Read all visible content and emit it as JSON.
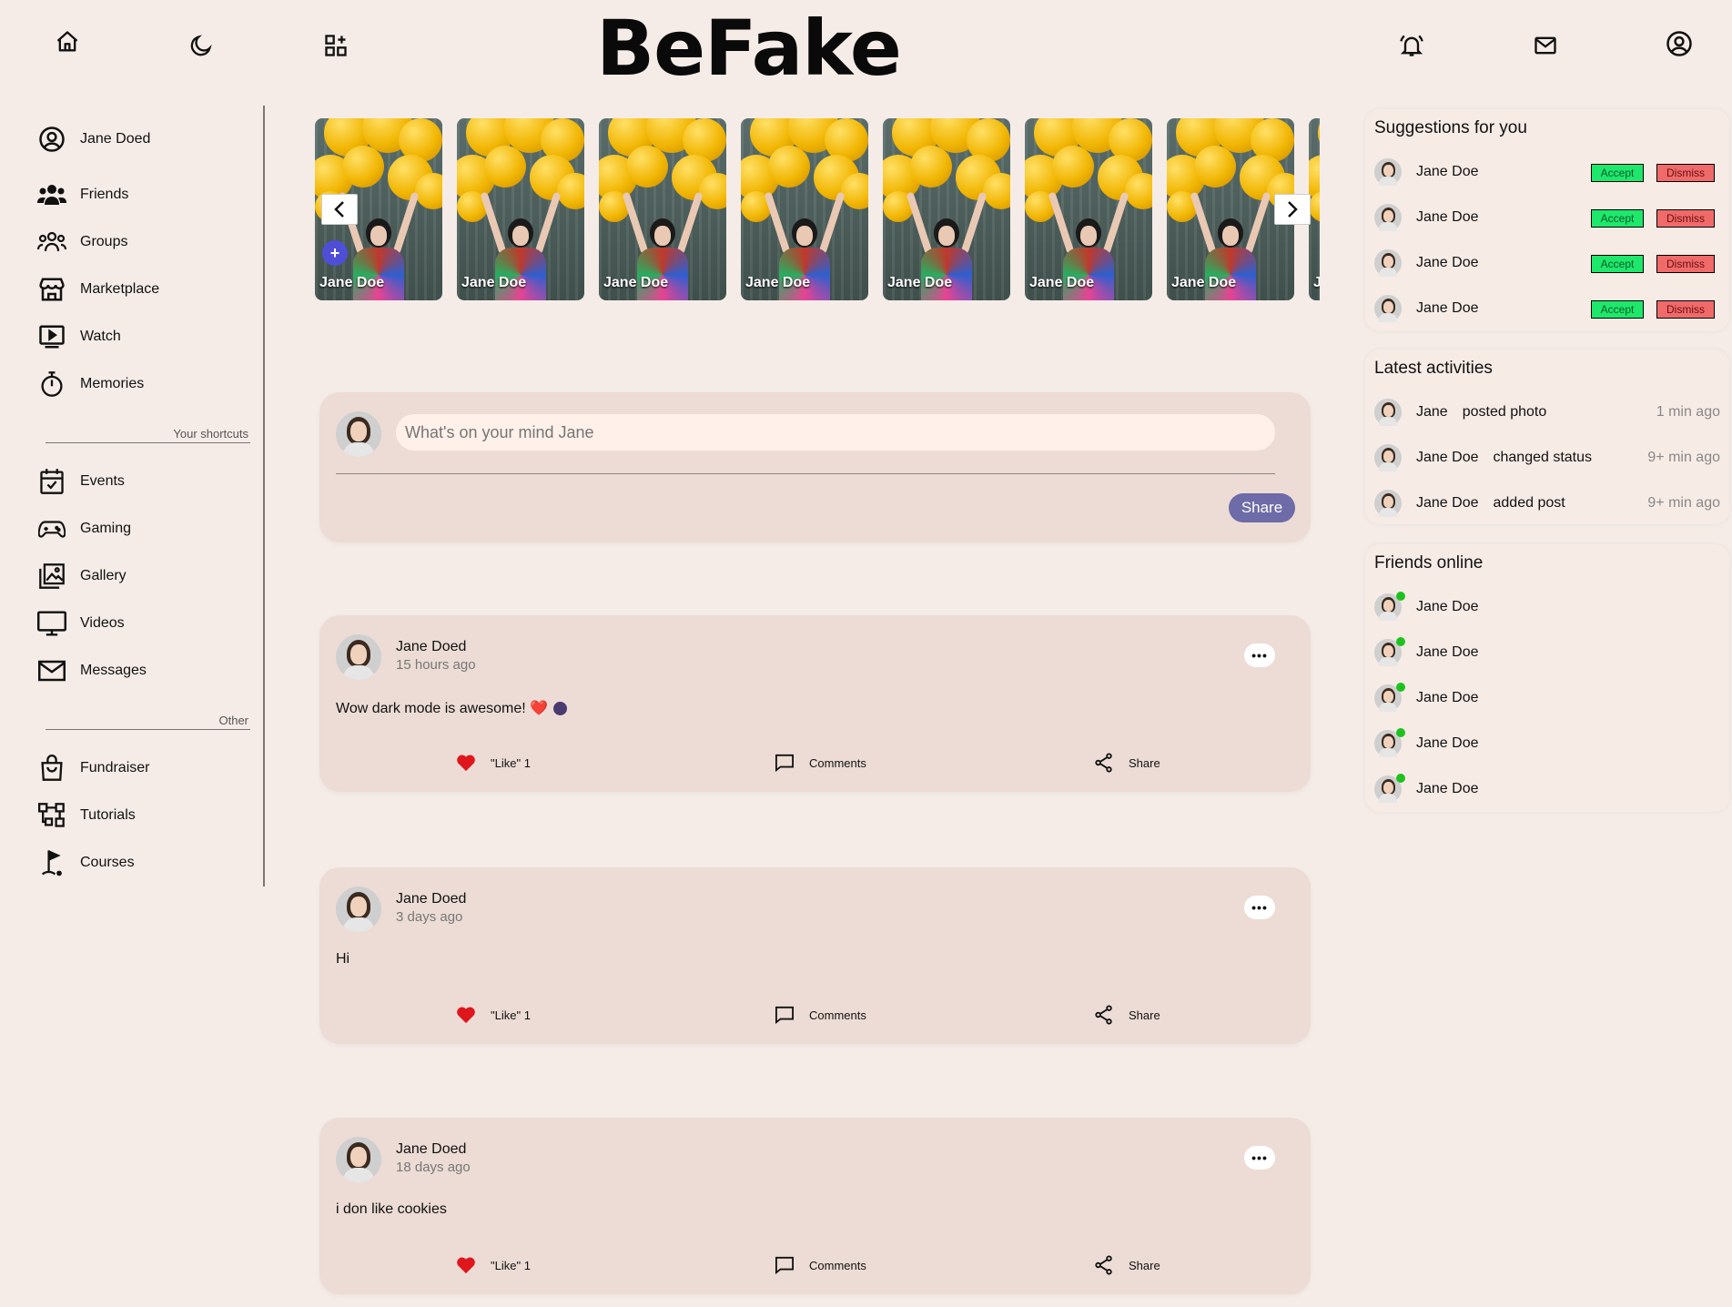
{
  "app": {
    "brand": "BeFake"
  },
  "topbar": {
    "icons": [
      "home-icon",
      "moon-icon",
      "grid-plus-icon",
      "bell-icon",
      "mail-icon",
      "user-circle-icon"
    ]
  },
  "sidebar": {
    "profile": "Jane Doed",
    "main": [
      "Friends",
      "Groups",
      "Marketplace",
      "Watch",
      "Memories"
    ],
    "shortcuts_label": "Your shortcuts",
    "shortcuts": [
      "Events",
      "Gaming",
      "Gallery",
      "Videos",
      "Messages"
    ],
    "other_label": "Other",
    "other": [
      "Fundraiser",
      "Tutorials",
      "Courses"
    ]
  },
  "stories": [
    "Jane Doe",
    "Jane Doe",
    "Jane Doe",
    "Jane Doe",
    "Jane Doe",
    "Jane Doe",
    "Jane Doe",
    "J"
  ],
  "composer": {
    "placeholder": "What's on your mind Jane",
    "share": "Share"
  },
  "posts": [
    {
      "author": "Jane Doed",
      "time": "15 hours ago",
      "text": "Wow dark mode is awesome! ❤️",
      "like": "\"Like\" 1",
      "comments": "Comments",
      "share": "Share"
    },
    {
      "author": "Jane Doed",
      "time": "3 days ago",
      "text": "Hi",
      "like": "\"Like\" 1",
      "comments": "Comments",
      "share": "Share"
    },
    {
      "author": "Jane Doed",
      "time": "18 days ago",
      "text": "i don like cookies",
      "like": "\"Like\" 1",
      "comments": "Comments",
      "share": "Share"
    }
  ],
  "suggestions": {
    "title": "Suggestions for you",
    "accept": "Accept",
    "dismiss": "Dismiss",
    "people": [
      "Jane Doe",
      "Jane Doe",
      "Jane Doe",
      "Jane Doe"
    ]
  },
  "activities": {
    "title": "Latest activities",
    "items": [
      {
        "name": "Jane",
        "action": "posted photo",
        "when": "1 min ago"
      },
      {
        "name": "Jane Doe",
        "action": "changed status",
        "when": "9+ min ago"
      },
      {
        "name": "Jane Doe",
        "action": "added post",
        "when": "9+ min ago"
      }
    ]
  },
  "online": {
    "title": "Friends online",
    "people": [
      "Jane Doe",
      "Jane Doe",
      "Jane Doe",
      "Jane Doe",
      "Jane Doe"
    ]
  },
  "colors": {
    "background": "#f5ece8",
    "card": "#ecdcd5",
    "share_button": "#6d6ba8",
    "accept": "#1ee86b",
    "dismiss": "#f06a6a",
    "like_heart": "#e0161d",
    "online": "#1ec21e"
  }
}
